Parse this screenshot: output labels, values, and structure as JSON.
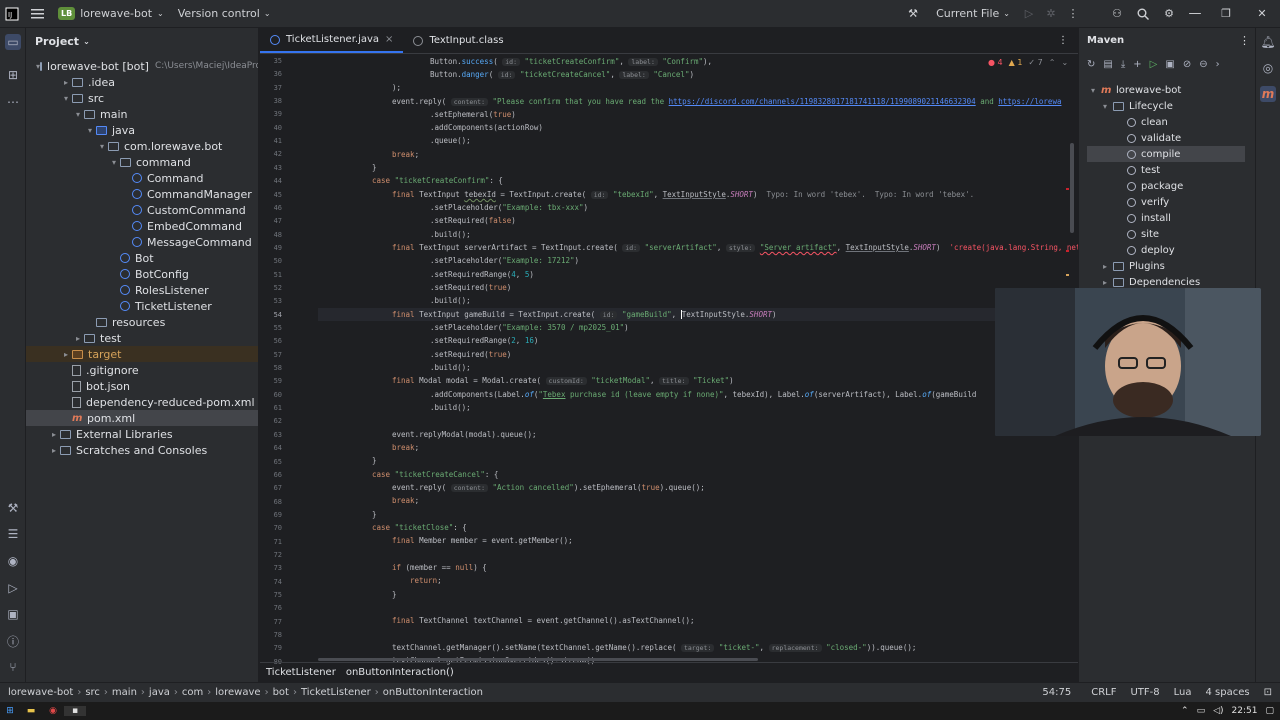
{
  "titlebar": {
    "project_badge": "LB",
    "project_name": "lorewave-bot",
    "vcs_label": "Version control",
    "run_config": "Current File",
    "window_controls": [
      "—",
      "❐",
      "✕"
    ]
  },
  "project_panel": {
    "title": "Project",
    "root_name": "lorewave-bot [bot]",
    "root_path": "C:\\Users\\Maciej\\IdeaPro",
    "items": [
      {
        "label": ".idea",
        "indent": 2,
        "type": "folder",
        "arrow": "▸"
      },
      {
        "label": "src",
        "indent": 2,
        "type": "folder",
        "arrow": "▾"
      },
      {
        "label": "main",
        "indent": 3,
        "type": "folder",
        "arrow": "▾"
      },
      {
        "label": "java",
        "indent": 4,
        "type": "folder-blue",
        "arrow": "▾"
      },
      {
        "label": "com.lorewave.bot",
        "indent": 5,
        "type": "folder",
        "arrow": "▾"
      },
      {
        "label": "command",
        "indent": 6,
        "type": "folder",
        "arrow": "▾"
      },
      {
        "label": "Command",
        "indent": 7,
        "type": "class",
        "arrow": ""
      },
      {
        "label": "CommandManager",
        "indent": 7,
        "type": "class",
        "arrow": ""
      },
      {
        "label": "CustomCommand",
        "indent": 7,
        "type": "class",
        "arrow": ""
      },
      {
        "label": "EmbedCommand",
        "indent": 7,
        "type": "class",
        "arrow": ""
      },
      {
        "label": "MessageCommand",
        "indent": 7,
        "type": "class",
        "arrow": ""
      },
      {
        "label": "Bot",
        "indent": 6,
        "type": "class",
        "arrow": ""
      },
      {
        "label": "BotConfig",
        "indent": 6,
        "type": "class",
        "arrow": ""
      },
      {
        "label": "RolesListener",
        "indent": 6,
        "type": "class",
        "arrow": ""
      },
      {
        "label": "TicketListener",
        "indent": 6,
        "type": "class",
        "arrow": ""
      },
      {
        "label": "resources",
        "indent": 4,
        "type": "folder",
        "arrow": ""
      },
      {
        "label": "test",
        "indent": 3,
        "type": "folder",
        "arrow": "▸"
      },
      {
        "label": "target",
        "indent": 2,
        "type": "folder-orange",
        "arrow": "▸"
      },
      {
        "label": ".gitignore",
        "indent": 2,
        "type": "file",
        "arrow": ""
      },
      {
        "label": "bot.json",
        "indent": 2,
        "type": "file",
        "arrow": ""
      },
      {
        "label": "dependency-reduced-pom.xml",
        "indent": 2,
        "type": "file",
        "arrow": ""
      },
      {
        "label": "pom.xml",
        "indent": 2,
        "type": "maven",
        "arrow": ""
      },
      {
        "label": "External Libraries",
        "indent": 1,
        "type": "folder",
        "arrow": "▸"
      },
      {
        "label": "Scratches and Consoles",
        "indent": 1,
        "type": "folder",
        "arrow": "▸"
      }
    ]
  },
  "editor": {
    "tabs": [
      {
        "label": "TicketListener.java",
        "active": true,
        "close": "×"
      },
      {
        "label": "TextInput.class",
        "active": false,
        "close": ""
      }
    ],
    "inspections": {
      "errors": "4",
      "warnings": "1",
      "weak": "7"
    },
    "line_numbers": [
      "35",
      "36",
      "37",
      "38",
      "39",
      "40",
      "41",
      "42",
      "43",
      "44",
      "45",
      "46",
      "47",
      "48",
      "49",
      "50",
      "51",
      "52",
      "53",
      "54",
      "55",
      "56",
      "57",
      "58",
      "59",
      "60",
      "61",
      "62",
      "63",
      "64",
      "65",
      "66",
      "67",
      "68",
      "69",
      "70",
      "71",
      "72",
      "73",
      "74",
      "75",
      "76",
      "77",
      "78",
      "79",
      "80"
    ],
    "breadcrumb": [
      "TicketListener",
      "onButtonInteraction()"
    ]
  },
  "maven": {
    "title": "Maven",
    "project": "lorewave-bot",
    "lifecycle": "Lifecycle",
    "phases": [
      "clean",
      "validate",
      "compile",
      "test",
      "package",
      "verify",
      "install",
      "site",
      "deploy"
    ],
    "selected": "compile",
    "plugins": "Plugins",
    "dependencies": "Dependencies"
  },
  "statusbar": {
    "path": [
      "lorewave-bot",
      "src",
      "main",
      "java",
      "com",
      "lorewave",
      "bot",
      "TicketListener",
      "onButtonInteraction"
    ],
    "position": "54:75",
    "line_sep": "CRLF",
    "encoding": "UTF-8",
    "language": "Lua",
    "indent": "4 spaces"
  },
  "taskbar": {
    "clock": "22:51"
  }
}
